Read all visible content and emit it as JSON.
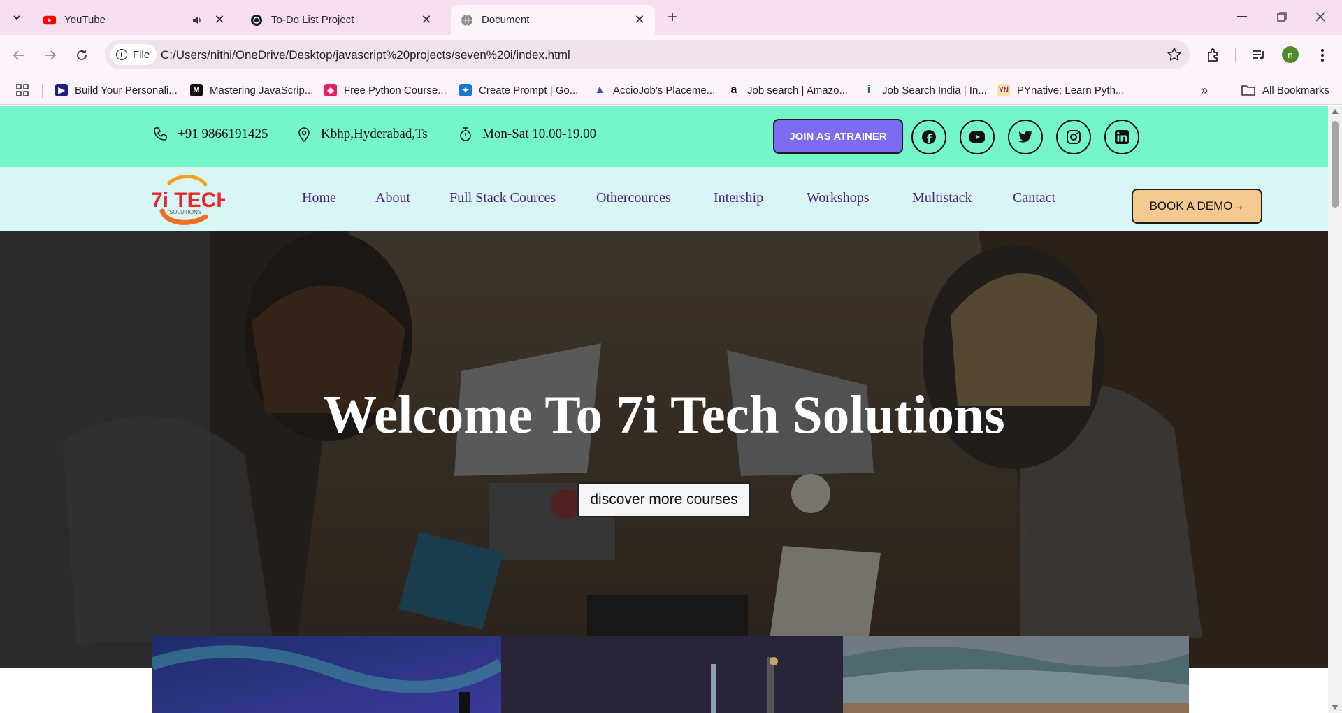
{
  "browser": {
    "tabs": [
      {
        "title": "YouTube",
        "active": false
      },
      {
        "title": "To-Do List Project",
        "active": false
      },
      {
        "title": "Document",
        "active": true
      }
    ],
    "address": {
      "chip_label": "File",
      "url": "C:/Users/nithi/OneDrive/Desktop/javascript%20projects/seven%20i/index.html"
    },
    "profile_initial": "n",
    "bookmarks": [
      {
        "label": "Build Your Personali...",
        "icon": "play-icon",
        "color": "#1a237e"
      },
      {
        "label": "Mastering JavaScrip...",
        "icon": "medium-icon",
        "color": "#111111"
      },
      {
        "label": "Free Python Course...",
        "icon": "cube-icon",
        "color": "#e91e63"
      },
      {
        "label": "Create Prompt | Go...",
        "icon": "puzzle-icon",
        "color": "#1976d2"
      },
      {
        "label": "AccioJob's Placeme...",
        "icon": "arrow-icon",
        "color": "#3f51b5"
      },
      {
        "label": "Job search | Amazo...",
        "icon": "amazon-icon",
        "color": "#111111"
      },
      {
        "label": "Job Search India | In...",
        "icon": "indeed-icon",
        "color": "#2557a7"
      },
      {
        "label": "PYnative: Learn Pyth...",
        "icon": "pynative-icon",
        "color": "#c2185b"
      }
    ],
    "all_bookmarks_label": "All Bookmarks"
  },
  "topbar": {
    "phone": "+91 9866191425",
    "location": "Kbhp,Hyderabad,Ts",
    "hours": "Mon-Sat 10.00-19.00",
    "join_label": "JOIN AS ATRAINER",
    "socials": [
      "facebook-icon",
      "youtube-icon",
      "twitter-icon",
      "instagram-icon",
      "linkedin-icon"
    ]
  },
  "navbar": {
    "logo_text": "7i TECH",
    "logo_sub": "SOLUTIONS",
    "links": [
      "Home",
      "About",
      "Full Stack Cources",
      "Othercources",
      "Intership",
      "Workshops",
      "Multistack",
      "Cantact"
    ],
    "demo_label": "BOOK A DEMO→"
  },
  "hero": {
    "title": "Welcome To 7i Tech Solutions",
    "button_label": "discover more courses"
  },
  "colors": {
    "topbar_bg": "#74f6c8",
    "navbar_bg": "#d8f6f5",
    "join_bg": "#7b6cf2",
    "demo_bg": "#f4c98f",
    "nav_link": "#4a2277"
  }
}
